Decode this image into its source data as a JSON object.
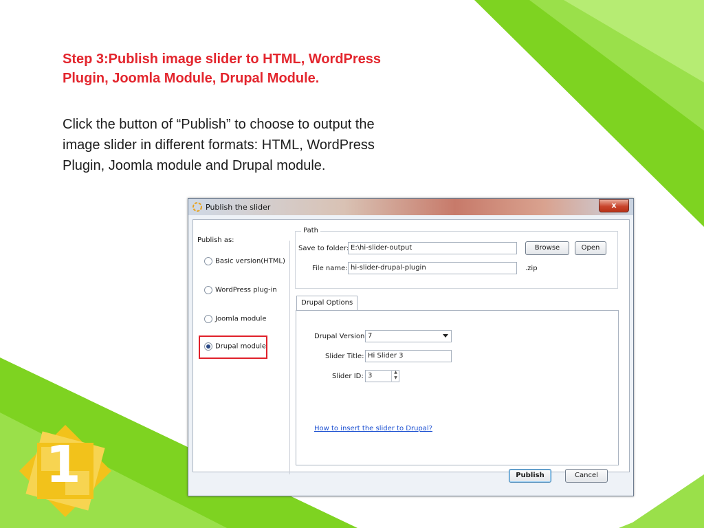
{
  "slide": {
    "heading_line1": "Step 3:Publish image slider to HTML, WordPress",
    "heading_line2": "Plugin, Joomla Module, Drupal Module.",
    "body_line1": "Click the button of “Publish” to choose to output the",
    "body_line2": "image slider in different formats: HTML, WordPress",
    "body_line3": "Plugin, Joomla module and Drupal module.",
    "logo_number": "1",
    "colors": {
      "heading": "#e3262e",
      "green": "#7ed321",
      "logo_yellow": "#f2c21b"
    }
  },
  "dialog": {
    "title": "Publish the slider",
    "close_label": "x",
    "publish_as_label": "Publish as:",
    "options": [
      {
        "label": "Basic version(HTML)",
        "checked": false
      },
      {
        "label": "WordPress plug-in",
        "checked": false
      },
      {
        "label": "Joomla module",
        "checked": false
      },
      {
        "label": "Drupal module",
        "checked": true
      }
    ],
    "path": {
      "legend": "Path",
      "save_to_folder_label": "Save to folder:",
      "save_to_folder_value": "E:\\hi-slider-output",
      "file_name_label": "File name:",
      "file_name_value": "hi-slider-drupal-plugin",
      "extension": ".zip",
      "browse_label": "Browse",
      "open_label": "Open"
    },
    "drupal_options": {
      "tab_label": "Drupal Options",
      "version_label": "Drupal Version:",
      "version_value": "7",
      "slider_title_label": "Slider Title:",
      "slider_title_value": "Hi Slider 3",
      "slider_id_label": "Slider ID:",
      "slider_id_value": "3",
      "help_link": "How to insert the slider to Drupal?"
    },
    "publish_label": "Publish",
    "cancel_label": "Cancel"
  }
}
